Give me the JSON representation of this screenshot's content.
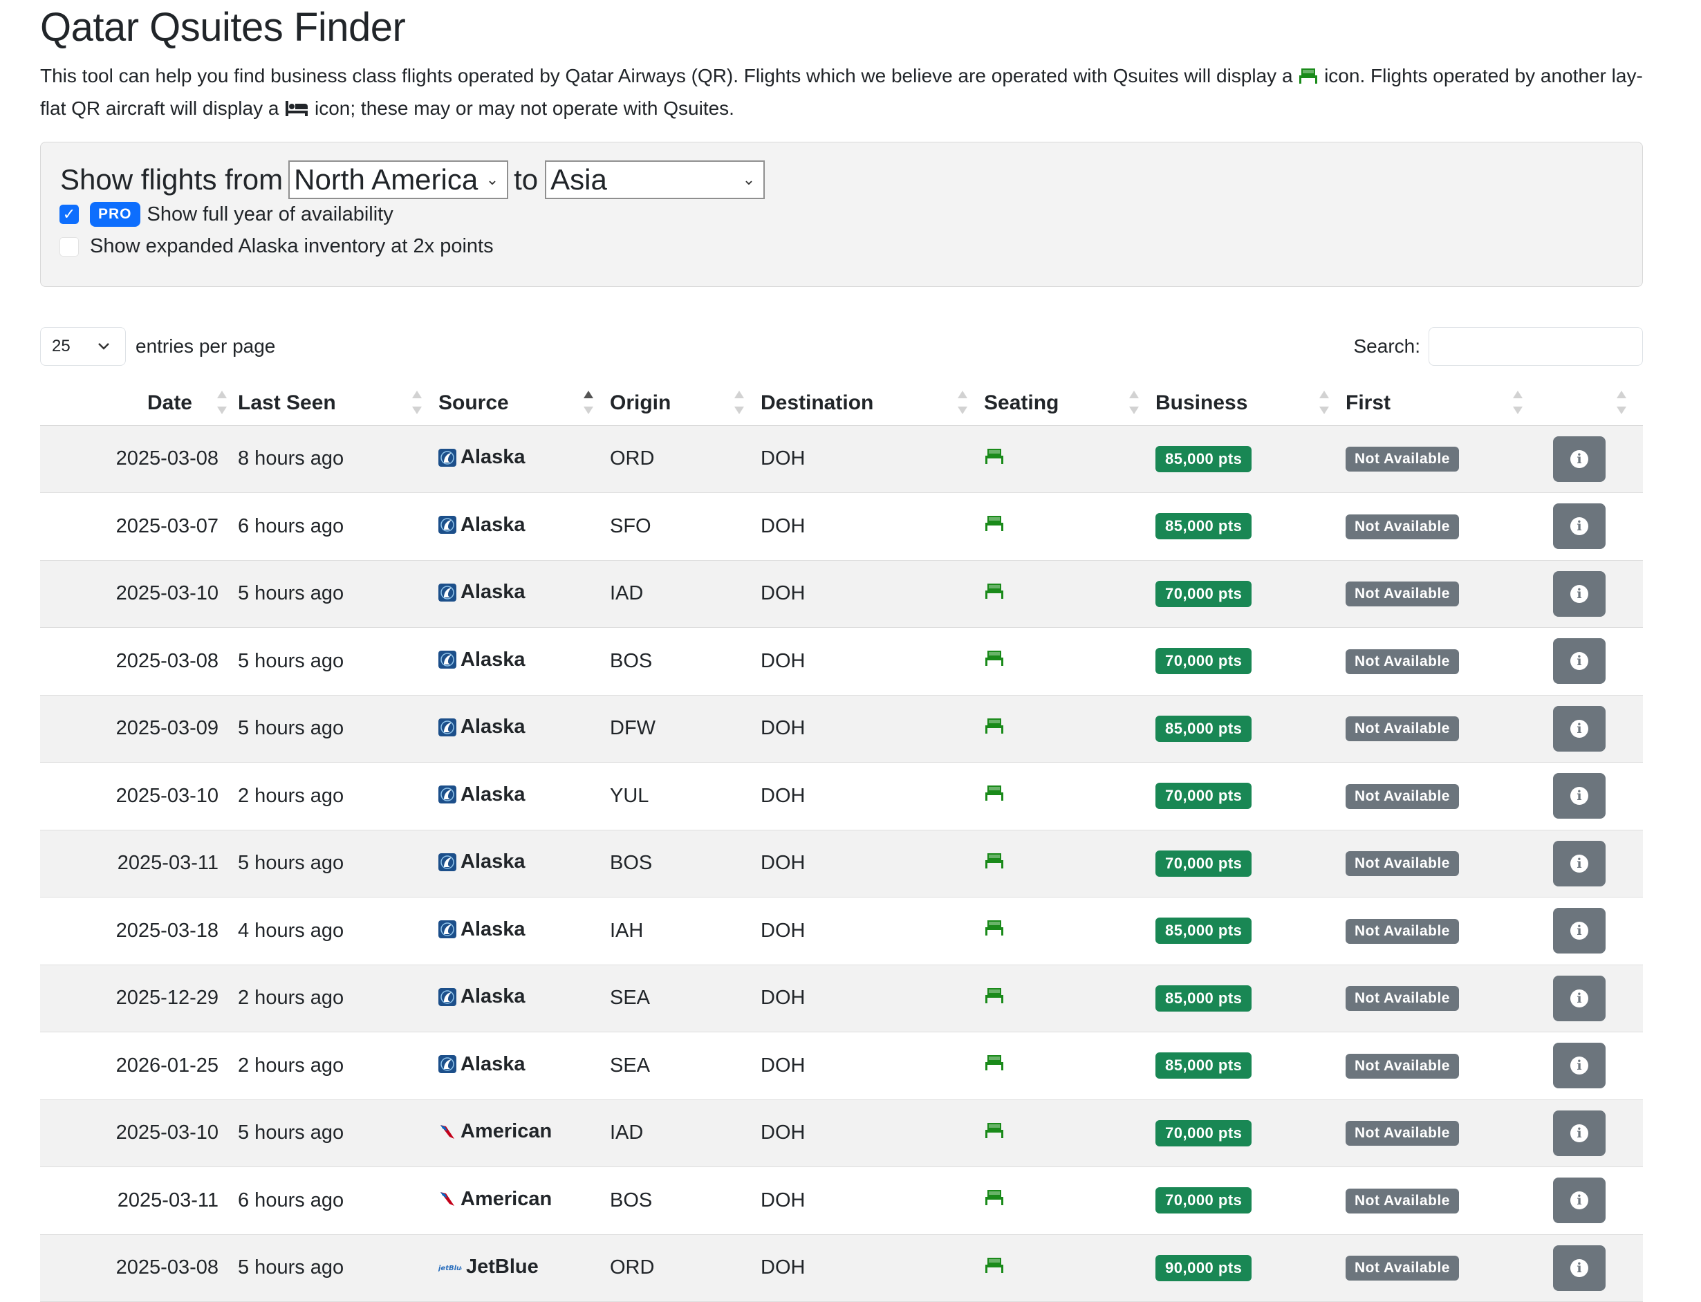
{
  "page": {
    "title": "Qatar Qsuites Finder",
    "intro_1": "This tool can help you find business class flights operated by Qatar Airways (QR). Flights which we believe are operated with Qsuites will display a",
    "intro_2": "icon. Flights operated by another lay-flat QR aircraft will display a",
    "intro_3": "icon; these may or may not operate with Qsuites."
  },
  "filters": {
    "prefix": "Show flights from",
    "from_value": "North America",
    "connector": "to",
    "to_value": "Asia",
    "pro_badge": "PRO",
    "full_year_label": "Show full year of availability",
    "full_year_checked": true,
    "alaska_label": "Show expanded Alaska inventory at 2x points",
    "alaska_checked": false
  },
  "table_controls": {
    "page_length": "25",
    "page_length_label": "entries per page",
    "search_label": "Search:",
    "search_value": ""
  },
  "columns": [
    "Date",
    "Last Seen",
    "Source",
    "Origin",
    "Destination",
    "Seating",
    "Business",
    "First",
    ""
  ],
  "sorted_column": "Source",
  "sort_direction": "ascending",
  "icons": {
    "qsuite": "qsuite-seat-icon",
    "lay_flat": "bed-icon",
    "info": "info-icon"
  },
  "colors": {
    "qsuite_icon": "#1a8a1a",
    "business_badge": "#198754",
    "first_badge": "#6c757d",
    "pro_badge": "#0d6efd"
  },
  "rows": [
    {
      "date": "2025-03-08",
      "last_seen": "8 hours ago",
      "source": "Alaska",
      "origin": "ORD",
      "destination": "DOH",
      "seating": "qsuite",
      "business": "85,000 pts",
      "first": "Not Available"
    },
    {
      "date": "2025-03-07",
      "last_seen": "6 hours ago",
      "source": "Alaska",
      "origin": "SFO",
      "destination": "DOH",
      "seating": "qsuite",
      "business": "85,000 pts",
      "first": "Not Available"
    },
    {
      "date": "2025-03-10",
      "last_seen": "5 hours ago",
      "source": "Alaska",
      "origin": "IAD",
      "destination": "DOH",
      "seating": "qsuite",
      "business": "70,000 pts",
      "first": "Not Available"
    },
    {
      "date": "2025-03-08",
      "last_seen": "5 hours ago",
      "source": "Alaska",
      "origin": "BOS",
      "destination": "DOH",
      "seating": "qsuite",
      "business": "70,000 pts",
      "first": "Not Available"
    },
    {
      "date": "2025-03-09",
      "last_seen": "5 hours ago",
      "source": "Alaska",
      "origin": "DFW",
      "destination": "DOH",
      "seating": "qsuite",
      "business": "85,000 pts",
      "first": "Not Available"
    },
    {
      "date": "2025-03-10",
      "last_seen": "2 hours ago",
      "source": "Alaska",
      "origin": "YUL",
      "destination": "DOH",
      "seating": "qsuite",
      "business": "70,000 pts",
      "first": "Not Available"
    },
    {
      "date": "2025-03-11",
      "last_seen": "5 hours ago",
      "source": "Alaska",
      "origin": "BOS",
      "destination": "DOH",
      "seating": "qsuite",
      "business": "70,000 pts",
      "first": "Not Available"
    },
    {
      "date": "2025-03-18",
      "last_seen": "4 hours ago",
      "source": "Alaska",
      "origin": "IAH",
      "destination": "DOH",
      "seating": "qsuite",
      "business": "85,000 pts",
      "first": "Not Available"
    },
    {
      "date": "2025-12-29",
      "last_seen": "2 hours ago",
      "source": "Alaska",
      "origin": "SEA",
      "destination": "DOH",
      "seating": "qsuite",
      "business": "85,000 pts",
      "first": "Not Available"
    },
    {
      "date": "2026-01-25",
      "last_seen": "2 hours ago",
      "source": "Alaska",
      "origin": "SEA",
      "destination": "DOH",
      "seating": "qsuite",
      "business": "85,000 pts",
      "first": "Not Available"
    },
    {
      "date": "2025-03-10",
      "last_seen": "5 hours ago",
      "source": "American",
      "origin": "IAD",
      "destination": "DOH",
      "seating": "qsuite",
      "business": "70,000 pts",
      "first": "Not Available"
    },
    {
      "date": "2025-03-11",
      "last_seen": "6 hours ago",
      "source": "American",
      "origin": "BOS",
      "destination": "DOH",
      "seating": "qsuite",
      "business": "70,000 pts",
      "first": "Not Available"
    },
    {
      "date": "2025-03-08",
      "last_seen": "5 hours ago",
      "source": "JetBlue",
      "origin": "ORD",
      "destination": "DOH",
      "seating": "qsuite",
      "business": "90,000 pts",
      "first": "Not Available"
    }
  ]
}
